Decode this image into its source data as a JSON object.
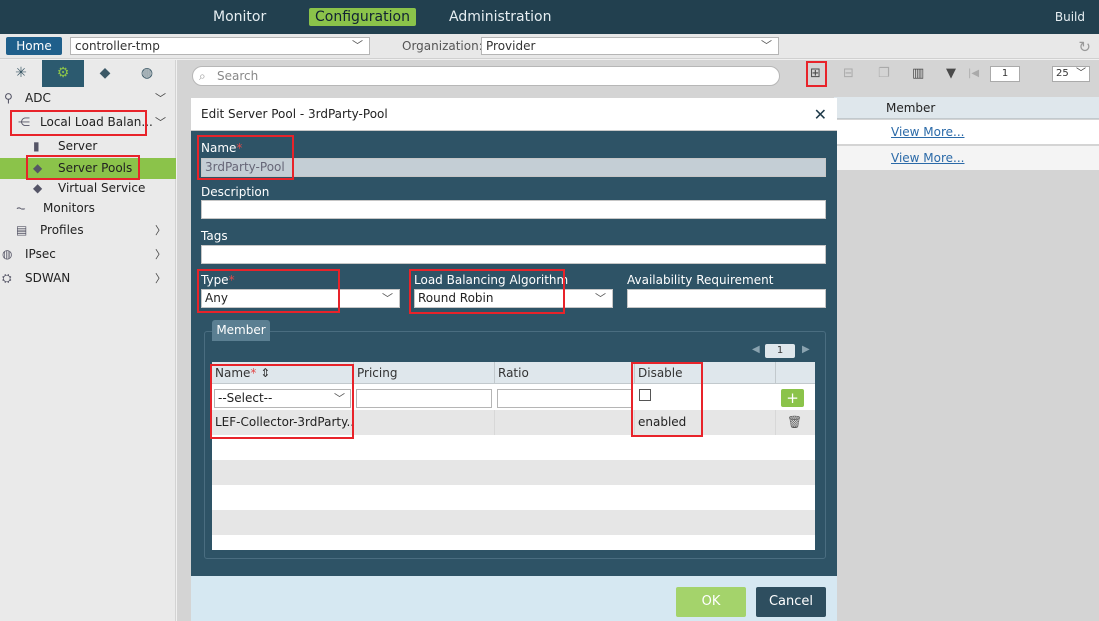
{
  "topnav": {
    "tabs": [
      "Monitor",
      "Configuration",
      "Administration"
    ],
    "build": "Build"
  },
  "subbar": {
    "home": "Home",
    "controller": "controller-tmp",
    "org_label": "Organization:",
    "org_value": "Provider"
  },
  "sidebar": {
    "items": [
      {
        "label": "ADC"
      },
      {
        "label": "Local Load Balan..."
      },
      {
        "label": "Server"
      },
      {
        "label": "Server Pools"
      },
      {
        "label": "Virtual Service"
      },
      {
        "label": "Monitors"
      },
      {
        "label": "Profiles"
      },
      {
        "label": "IPsec"
      },
      {
        "label": "SDWAN"
      }
    ]
  },
  "main": {
    "search_placeholder": "Search",
    "page_number": "1",
    "page_size": "25",
    "table_header": "Member",
    "rows": [
      {
        "link": "View More..."
      },
      {
        "link": "View More..."
      }
    ]
  },
  "modal": {
    "title": "Edit Server Pool - 3rdParty-Pool",
    "name_label": "Name",
    "name_value": "3rdParty-Pool",
    "description_label": "Description",
    "tags_label": "Tags",
    "type_label": "Type",
    "type_value": "Any",
    "lb_label": "Load Balancing Algorithm",
    "lb_value": "Round Robin",
    "avail_label": "Availability Requirement",
    "member_tab": "Member",
    "member_page": "1",
    "member_columns": [
      "Name",
      "Pricing",
      "Ratio",
      "Disable"
    ],
    "select_placeholder": "--Select--",
    "member_rows": [
      {
        "name": "LEF-Collector-3rdParty...",
        "disable": "enabled"
      }
    ],
    "ok": "OK",
    "cancel": "Cancel"
  }
}
